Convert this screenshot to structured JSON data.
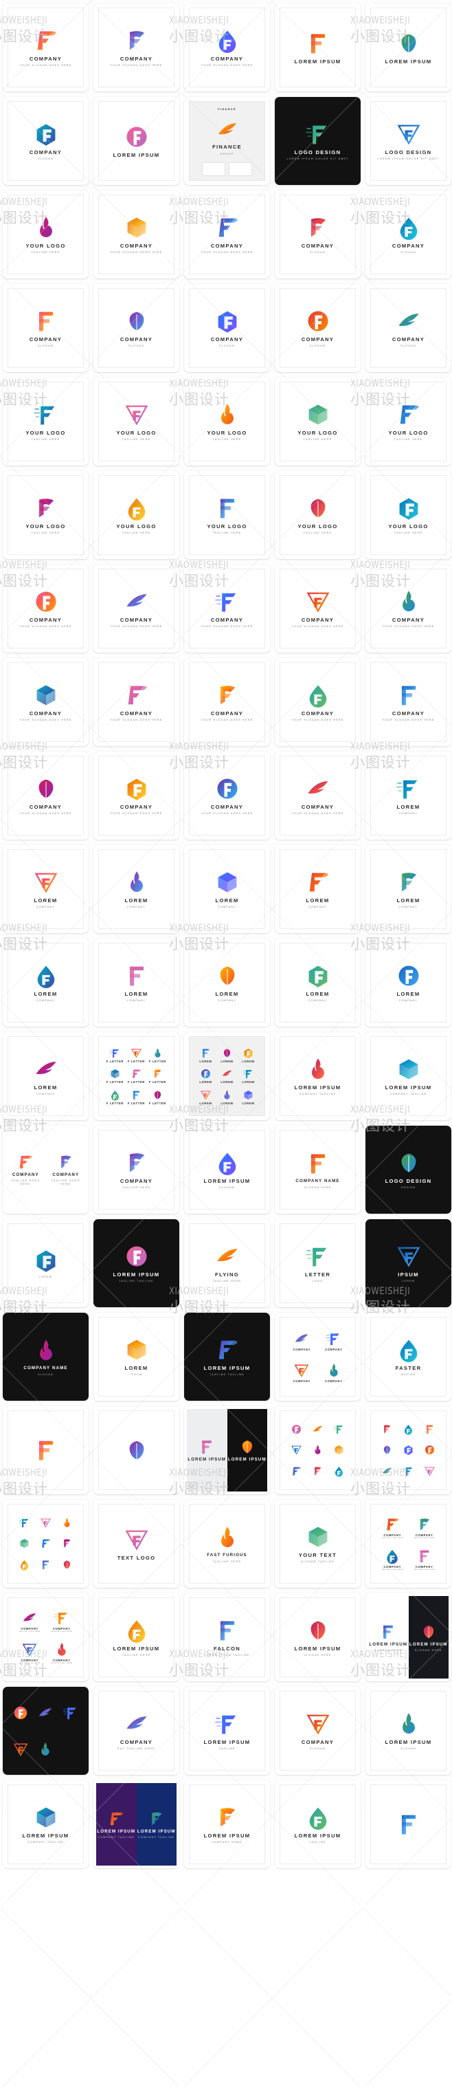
{
  "page": {
    "kind": "logo-template-gallery-sheet",
    "columns": 5,
    "watermark": {
      "latin": "XIAOWEISHEJI",
      "cjk": "小图设计"
    },
    "background": "#fdfdfd"
  },
  "cards": [
    {
      "n": "logo-card-company-p-wing",
      "title": "COMPANY",
      "sub": "Your Slogan Goes Here",
      "style": "light"
    },
    {
      "n": "logo-card-company-f-ribbon",
      "title": "COMPANY",
      "sub": "Your Slogan Goes Here",
      "style": "light"
    },
    {
      "n": "logo-card-company-droplet",
      "title": "COMPANY",
      "sub": "Your Slogan Goes Here",
      "style": "light"
    },
    {
      "n": "logo-card-lorem-ipsum-dots",
      "title": "LOREM IPSUM",
      "sub": "",
      "style": "light"
    },
    {
      "n": "logo-card-lorem-ipsum-wood-f",
      "title": "LOREM IPSUM",
      "sub": "",
      "style": "light"
    },
    {
      "n": "logo-card-company-circle-f",
      "title": "COMPANY",
      "sub": "SLOGAN",
      "style": "light"
    },
    {
      "n": "logo-card-lorem-ipsum-outline-f",
      "title": "LOREM IPSUM",
      "sub": "",
      "style": "light"
    },
    {
      "n": "logo-card-finance-group-mockup",
      "title": "FINANCE",
      "sub": "GROUP",
      "style": "mockup"
    },
    {
      "n": "logo-card-logo-design-teal-leaf",
      "title": "LOGO DESIGN",
      "sub": "Lorem ipsum dolor sit amet",
      "style": "dark"
    },
    {
      "n": "logo-card-logo-design-gradient-wing",
      "title": "LOGO DESIGN",
      "sub": "Lorem ipsum dolor sit amet",
      "style": "light"
    },
    {
      "n": "logo-card-your-logo-blue-curl",
      "title": "YOUR LOGO",
      "sub": "TAGLINE HERE",
      "style": "light"
    },
    {
      "n": "logo-card-company-flame",
      "title": "COMPANY",
      "sub": "Your Slogan Goes Here",
      "style": "light"
    },
    {
      "n": "logo-card-company-pink-square",
      "title": "COMPANY",
      "sub": "Your Slogan Goes Here",
      "style": "light"
    },
    {
      "n": "logo-card-company-leaf-f",
      "title": "COMPANY",
      "sub": "SLOGAN",
      "style": "light"
    },
    {
      "n": "logo-card-company-green-blue-plant",
      "title": "COMPANY",
      "sub": "SLOGAN",
      "style": "light"
    },
    {
      "n": "logo-card-company-magenta-line-f",
      "title": "COMPANY",
      "sub": "SLOGAN",
      "style": "light"
    },
    {
      "n": "logo-card-company-green-blue-block",
      "title": "COMPANY",
      "sub": "SLOGAN",
      "style": "light"
    },
    {
      "n": "logo-card-company-orange-wave",
      "title": "COMPANY",
      "sub": "SLOGAN",
      "style": "light"
    },
    {
      "n": "logo-card-company-blue-arrow-house",
      "title": "COMPANY",
      "sub": "SLOGAN",
      "style": "light"
    },
    {
      "n": "logo-card-company-yellow-red-bar",
      "title": "COMPANY",
      "sub": "SLOGAN",
      "style": "light"
    },
    {
      "n": "logo-card-your-logo-g-cube",
      "title": "YOUR LOGO",
      "sub": "TAGLINE HERE",
      "style": "light"
    },
    {
      "n": "logo-card-your-logo-blue-feather",
      "title": "YOUR LOGO",
      "sub": "TAGLINE HERE",
      "style": "light"
    },
    {
      "n": "logo-card-your-logo-if-flag",
      "title": "YOUR LOGO",
      "sub": "TAGLINE HERE",
      "style": "light"
    },
    {
      "n": "logo-card-your-logo-knot",
      "title": "YOUR LOGO",
      "sub": "TAGLINE HERE",
      "style": "light"
    },
    {
      "n": "logo-card-your-logo-wing-swoosh",
      "title": "YOUR LOGO",
      "sub": "TAGLINE HERE",
      "style": "light"
    },
    {
      "n": "logo-card-your-logo-blue-ribbon-m",
      "title": "YOUR LOGO",
      "sub": "TAGLINE HERE",
      "style": "light"
    },
    {
      "n": "logo-card-your-logo-script-f",
      "title": "YOUR LOGO",
      "sub": "TAGLINE HERE",
      "style": "light"
    },
    {
      "n": "logo-card-your-logo-pixel-f",
      "title": "YOUR LOGO",
      "sub": "TAGLINE HERE",
      "style": "light"
    },
    {
      "n": "logo-card-your-logo-hexagon",
      "title": "YOUR LOGO",
      "sub": "TAGLINE HERE",
      "style": "light"
    },
    {
      "n": "logo-card-your-logo-gray-blue-f",
      "title": "YOUR LOGO",
      "sub": "TAGLINE HERE",
      "style": "light"
    },
    {
      "n": "logo-card-company-hex-tech",
      "title": "COMPANY",
      "sub": "Your Slogan Goes Here",
      "style": "light"
    },
    {
      "n": "logo-card-company-loop-swirl",
      "title": "COMPANY",
      "sub": "Your Slogan Goes Here",
      "style": "light"
    },
    {
      "n": "logo-card-company-pixel-wing",
      "title": "COMPANY",
      "sub": "Your Slogan Goes Here",
      "style": "light"
    },
    {
      "n": "logo-card-company-purple-leaf",
      "title": "COMPANY",
      "sub": "Your Slogan Goes Here",
      "style": "light"
    },
    {
      "n": "logo-card-company-fire-swirl",
      "title": "COMPANY",
      "sub": "Your Slogan Goes Here",
      "style": "light"
    },
    {
      "n": "logo-card-company-splash-dots",
      "title": "COMPANY",
      "sub": "Your Slogan Goes Here",
      "style": "light"
    },
    {
      "n": "logo-card-company-flag-pin",
      "title": "COMPANY",
      "sub": "Your Slogan Goes Here",
      "style": "light"
    },
    {
      "n": "logo-card-company-speed-lines",
      "title": "COMPANY",
      "sub": "Your Slogan Goes Here",
      "style": "light"
    },
    {
      "n": "logo-card-company-orange-flag",
      "title": "COMPANY",
      "sub": "Your Slogan Goes Here",
      "style": "light"
    },
    {
      "n": "logo-card-company-globe-swoosh",
      "title": "COMPANY",
      "sub": "Your Slogan Goes Here",
      "style": "light"
    },
    {
      "n": "logo-card-company-blue-speed-f",
      "title": "COMPANY",
      "sub": "Your Slogan Goes Here",
      "style": "light"
    },
    {
      "n": "logo-card-company-leaf-pair",
      "title": "COMPANY",
      "sub": "Your Slogan Goes Here",
      "style": "light"
    },
    {
      "n": "logo-card-company-pink-blue-f",
      "title": "COMPANY",
      "sub": "Your Slogan Goes Here",
      "style": "light"
    },
    {
      "n": "logo-card-company-orange-p-pill",
      "title": "COMPANY",
      "sub": "Your Slogan Goes Here",
      "style": "light"
    },
    {
      "n": "logo-card-lorem-blue-bolt",
      "title": "LOREM",
      "sub": "COMPANY",
      "style": "light"
    },
    {
      "n": "logo-card-lorem-green-f",
      "title": "LOREM",
      "sub": "COMPANY",
      "style": "light"
    },
    {
      "n": "logo-card-lorem-blue-green-f",
      "title": "LOREM",
      "sub": "COMPANY",
      "style": "light"
    },
    {
      "n": "logo-card-lorem-rainbow-ribbon",
      "title": "LOREM",
      "sub": "COMPANY",
      "style": "light"
    },
    {
      "n": "logo-card-lorem-orange-e",
      "title": "LOREM",
      "sub": "COMPANY",
      "style": "light"
    },
    {
      "n": "logo-card-lorem-orange-blue-f",
      "title": "LOREM",
      "sub": "COMPANY",
      "style": "light"
    },
    {
      "n": "logo-card-lorem-circle-leaf",
      "title": "LOREM",
      "sub": "COMPANY",
      "style": "light"
    },
    {
      "n": "logo-card-lorem-paint-f",
      "title": "LOREM",
      "sub": "COMPANY",
      "style": "light"
    },
    {
      "n": "logo-card-lorem-flame-f",
      "title": "LOREM",
      "sub": "COMPANY",
      "style": "light"
    },
    {
      "n": "logo-card-lorem-pink-outline-f",
      "title": "LOREM",
      "sub": "COMPANY",
      "style": "light"
    },
    {
      "n": "logo-card-lorem-red-green-flag",
      "title": "LOREM",
      "sub": "COMPANY",
      "style": "light"
    },
    {
      "n": "logo-card-lorem-cube-f",
      "title": "LOREM",
      "sub": "COMPANY",
      "style": "light"
    },
    {
      "n": "logo-card-fletter-sheet",
      "title": "F LETTER",
      "sub": "",
      "style": "sheet9"
    },
    {
      "n": "logo-card-lorem-sheet-colored",
      "title": "LOREM",
      "sub": "",
      "style": "sheet9g"
    },
    {
      "n": "logo-card-lorem-ipsum-blue-green-wing",
      "title": "LOREM IPSUM",
      "sub": "COMPANY TAGLINE",
      "style": "light"
    },
    {
      "n": "logo-card-lorem-ipsum-oval-leaf",
      "title": "LOREM IPSUM",
      "sub": "COMPANY TAGLINE",
      "style": "light"
    },
    {
      "n": "logo-card-company-branding-pair",
      "title": "COMPANY",
      "sub": "TAGLINE GOES HERE",
      "style": "branding"
    },
    {
      "n": "logo-card-company-hummingbird",
      "title": "COMPANY",
      "sub": "TAGLINE HERE",
      "style": "light"
    },
    {
      "n": "logo-card-loremipsum-ribbon-f",
      "title": "LOREM IPSUM",
      "sub": "SLOGAN",
      "style": "light"
    },
    {
      "n": "logo-card-company-name-blue-f",
      "title": "COMPANY NAME",
      "sub": "SLOGAN HERE",
      "style": "light"
    },
    {
      "n": "logo-card-logo-design-red-triangle",
      "title": "LOGO DESIGN",
      "sub": "DESIGN",
      "style": "dark"
    },
    {
      "n": "logo-card-red-triangle-f",
      "title": "",
      "sub": "LOREM",
      "style": "light"
    },
    {
      "n": "logo-card-lorem-ipsum-gold-v",
      "title": "LOREM IPSUM",
      "sub": "TAGLINE TAGLINE",
      "style": "dark"
    },
    {
      "n": "logo-card-flying-orange-wing",
      "title": "FLYING",
      "sub": "TAGLINE HERE",
      "style": "light"
    },
    {
      "n": "logo-card-letter-logo-blue-f",
      "title": "LETTER",
      "sub": "LOGO",
      "style": "light"
    },
    {
      "n": "logo-card-ipsum-white-triangle",
      "title": "IPSUM",
      "sub": "LOREM",
      "style": "dark"
    },
    {
      "n": "logo-card-company-name-blue-silver",
      "title": "COMPANY NAME",
      "sub": "SLOGAN",
      "style": "dark"
    },
    {
      "n": "logo-card-lorem-ipsum-blue-lines",
      "title": "LOREM",
      "sub": "IPSUM",
      "style": "light"
    },
    {
      "n": "logo-card-lorem-ipsum-orange-silver",
      "title": "LOREM IPSUM",
      "sub": "TAGLINE TAGLINE",
      "style": "dark"
    },
    {
      "n": "logo-card-company-quad-set",
      "title": "COMPANY",
      "sub": "",
      "style": "quad"
    },
    {
      "n": "logo-card-faster-design",
      "title": "FASTER",
      "sub": "DESIGN",
      "style": "light"
    },
    {
      "n": "logo-card-orange-purple-f",
      "title": "",
      "sub": "",
      "style": "light"
    },
    {
      "n": "logo-card-rainbow-hex-e",
      "title": "",
      "sub": "",
      "style": "light"
    },
    {
      "n": "logo-card-monogram-pair-dark",
      "title": "LOREM IPSUM",
      "sub": "",
      "style": "splitmono"
    },
    {
      "n": "logo-card-f-grid-nine-a",
      "title": "",
      "sub": "",
      "style": "sheet9c"
    },
    {
      "n": "logo-card-f-grid-nine-b",
      "title": "",
      "sub": "",
      "style": "sheet9c"
    },
    {
      "n": "logo-card-f-grid-nine-c",
      "title": "",
      "sub": "",
      "style": "sheet9c"
    },
    {
      "n": "logo-card-text-logo-teal",
      "title": "TEXT LOGO",
      "sub": "",
      "style": "light"
    },
    {
      "n": "logo-card-fast-furious",
      "title": "FAST FURIOUS",
      "sub": "TAGLINE HERE",
      "style": "light"
    },
    {
      "n": "logo-card-your-text-plant",
      "title": "Your Text",
      "sub": "SLOGAN TAGLINE",
      "style": "light"
    },
    {
      "n": "logo-card-company-wing-quad",
      "title": "COMPANY",
      "sub": "TAGLINE GOES HERE",
      "style": "quad"
    },
    {
      "n": "logo-card-company-f-quad-two",
      "title": "COMPANY",
      "sub": "TAGLINE GOES HERE",
      "style": "quad"
    },
    {
      "n": "logo-card-loremipsum-note-f",
      "title": "LOREM IPSUM",
      "sub": "TAGLINE HERE",
      "style": "light"
    },
    {
      "n": "logo-card-falcon-brand",
      "title": "FALCON",
      "sub": "LOREM IPSUM TAGLINE",
      "style": "light"
    },
    {
      "n": "logo-card-lorem-ipsum-green-orange",
      "title": "LOREM IPSUM",
      "sub": "SLOGAN HERE",
      "style": "light"
    },
    {
      "n": "logo-card-loremipsum-dual-dark",
      "title": "LOREM IPSUM",
      "sub": "SLOGAN HERE",
      "style": "splitdark"
    },
    {
      "n": "logo-card-f-set-black-bg",
      "title": "",
      "sub": "",
      "style": "darkset"
    },
    {
      "n": "logo-card-company-purple-swoosh",
      "title": "COMPANY",
      "sub": "PUT TAGLINE HERE",
      "style": "light"
    },
    {
      "n": "logo-card-loremipsum-pegasus",
      "title": "LOREM IPSUM",
      "sub": "TAGLINE",
      "style": "light"
    },
    {
      "n": "logo-card-company-green-blue-f",
      "title": "COMPANY",
      "sub": "SLOGAN",
      "style": "light"
    },
    {
      "n": "logo-card-loremipsum-play-note",
      "title": "LOREM IPSUM",
      "sub": "SLOGAN",
      "style": "light"
    },
    {
      "n": "logo-card-lorem-ipsum-feather-dots",
      "title": "LOREM IPSUM",
      "sub": "COMPANY TAGLINE",
      "style": "light"
    },
    {
      "n": "logo-card-lorem-ipsum-crest-pair",
      "title": "LOREM IPSUM",
      "sub": "COMPANY TAGLINE",
      "style": "splitcrest"
    },
    {
      "n": "logo-card-lorem-ipsum-orange-bird",
      "title": "LOREM IPSUM",
      "sub": "COMPANY NAME",
      "style": "light"
    },
    {
      "n": "logo-card-loremipsum-emblem",
      "title": "LOREM IPSUM",
      "sub": "TAGLINE",
      "style": "light"
    },
    {
      "n": "logo-card-cheetah-red-black",
      "title": "",
      "sub": "",
      "style": "light"
    }
  ]
}
